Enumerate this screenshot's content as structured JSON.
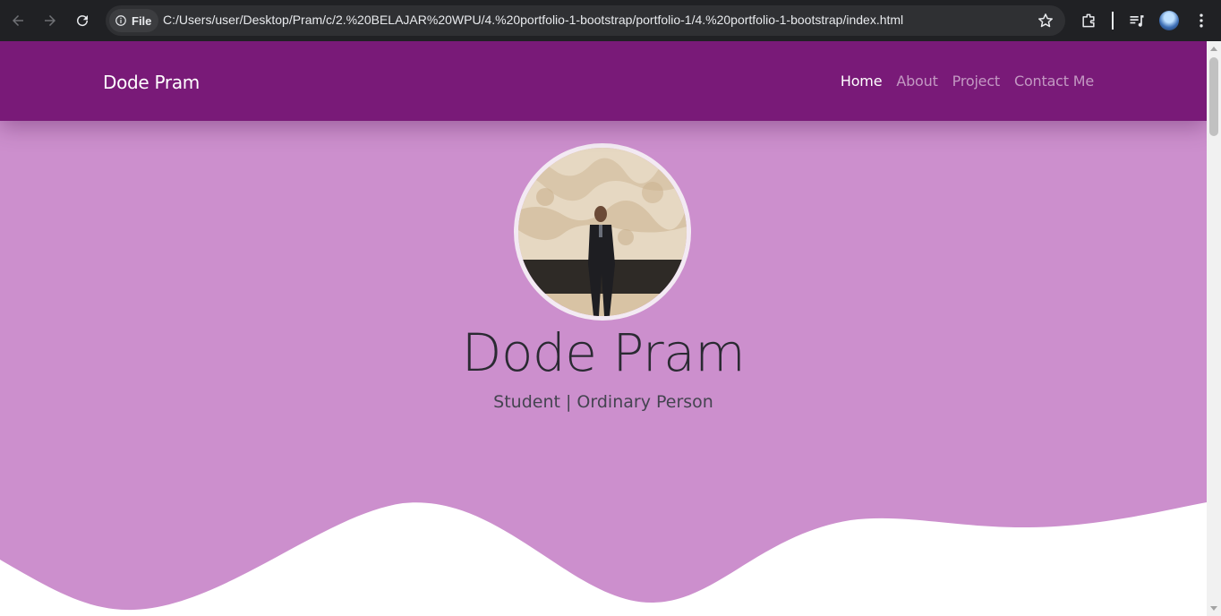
{
  "browser": {
    "site_info_label": "File",
    "url": "C:/Users/user/Desktop/Pram/c/2.%20BELAJAR%20WPU/4.%20portfolio-1-bootstrap/portfolio-1/4.%20portfolio-1-bootstrap/index.html"
  },
  "navbar": {
    "brand": "Dode Pram",
    "items": [
      {
        "label": "Home",
        "active": true
      },
      {
        "label": "About",
        "active": false
      },
      {
        "label": "Project",
        "active": false
      },
      {
        "label": "Contact Me",
        "active": false
      }
    ]
  },
  "hero": {
    "title": "Dode Pram",
    "subtitle": "Student | Ordinary Person"
  },
  "colors": {
    "navbar_bg": "#791a78",
    "hero_bg": "#cc8fcd",
    "chrome_bg": "#202124"
  },
  "icons": [
    "back-arrow-icon",
    "forward-arrow-icon",
    "reload-icon",
    "info-icon",
    "star-icon",
    "extensions-icon",
    "media-controls-icon",
    "profile-avatar-icon",
    "more-vertical-icon"
  ]
}
